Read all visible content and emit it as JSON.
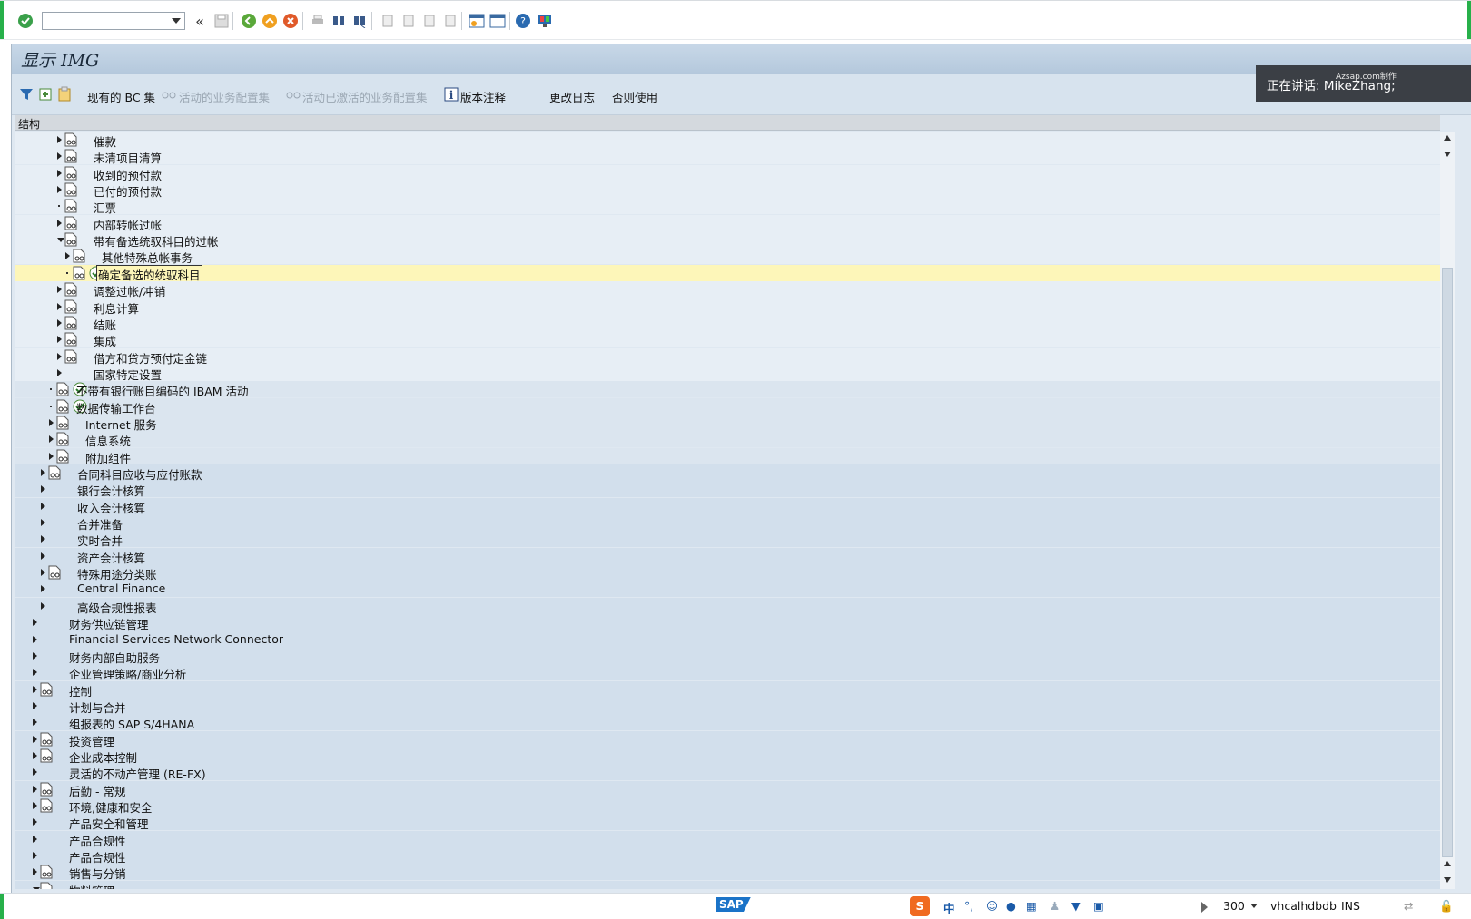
{
  "window_title": "显示 IMG",
  "toolbar": {
    "command_field_value": "",
    "back_label": "«"
  },
  "app_toolbar": {
    "current_bc_sets": "现有的 BC 集",
    "activated_bc_sets": "活动的业务配置集",
    "activated_bc_sets_for_activity": "活动已激活的业务配置集",
    "release_notes": "版本注释",
    "change_log": "更改日志",
    "deprecated": "否则使用"
  },
  "overlay": {
    "speaking": "正在讲话: MikeZhang;",
    "watermark": "Azsap.com制作"
  },
  "column_header": "结构",
  "tree_rows": [
    {
      "label": "催款",
      "indent": 3,
      "arrow": "r",
      "doc": true,
      "check": false
    },
    {
      "label": "未清项目清算",
      "indent": 3,
      "arrow": "r",
      "doc": true,
      "check": false
    },
    {
      "label": "收到的预付款",
      "indent": 3,
      "arrow": "r",
      "doc": true,
      "check": false
    },
    {
      "label": "已付的预付款",
      "indent": 3,
      "arrow": "r",
      "doc": true,
      "check": false
    },
    {
      "label": "汇票",
      "indent": 3,
      "arrow": "dot",
      "doc": true,
      "check": false
    },
    {
      "label": "内部转帐过帐",
      "indent": 3,
      "arrow": "r",
      "doc": true,
      "check": false
    },
    {
      "label": "带有备选统驭科目的过帐",
      "indent": 3,
      "arrow": "d",
      "doc": true,
      "check": false
    },
    {
      "label": "其他特殊总帐事务",
      "indent": 4,
      "arrow": "r",
      "doc": true,
      "check": false
    },
    {
      "label": "确定备选的统驭科目",
      "indent": 4,
      "arrow": "dot",
      "doc": true,
      "check": true,
      "selected": true
    },
    {
      "label": "调整过帐/冲销",
      "indent": 3,
      "arrow": "r",
      "doc": true,
      "check": false
    },
    {
      "label": "利息计算",
      "indent": 3,
      "arrow": "r",
      "doc": true,
      "check": false
    },
    {
      "label": "结账",
      "indent": 3,
      "arrow": "r",
      "doc": true,
      "check": false
    },
    {
      "label": "集成",
      "indent": 3,
      "arrow": "r",
      "doc": true,
      "check": false
    },
    {
      "label": "借方和贷方预付定金链",
      "indent": 3,
      "arrow": "r",
      "doc": true,
      "check": false
    },
    {
      "label": "国家特定设置",
      "indent": 3,
      "arrow": "r",
      "doc": false,
      "check": false
    },
    {
      "label": "不带有银行账目编码的 IBAM 活动",
      "indent": 2,
      "arrow": "dot",
      "doc": true,
      "check": true
    },
    {
      "label": "数据传输工作台",
      "indent": 2,
      "arrow": "dot",
      "doc": true,
      "check": true
    },
    {
      "label": "Internet 服务",
      "indent": 2,
      "arrow": "r",
      "doc": true,
      "check": false
    },
    {
      "label": "信息系统",
      "indent": 2,
      "arrow": "r",
      "doc": true,
      "check": false
    },
    {
      "label": "附加组件",
      "indent": 2,
      "arrow": "r",
      "doc": true,
      "check": false
    },
    {
      "label": "合同科目应收与应付账款",
      "indent": 1,
      "arrow": "r",
      "doc": true,
      "check": false
    },
    {
      "label": "银行会计核算",
      "indent": 1,
      "arrow": "r",
      "doc": false,
      "check": false
    },
    {
      "label": "收入会计核算",
      "indent": 1,
      "arrow": "r",
      "doc": false,
      "check": false
    },
    {
      "label": "合并准备",
      "indent": 1,
      "arrow": "r",
      "doc": false,
      "check": false
    },
    {
      "label": "实时合并",
      "indent": 1,
      "arrow": "r",
      "doc": false,
      "check": false
    },
    {
      "label": "资产会计核算",
      "indent": 1,
      "arrow": "r",
      "doc": false,
      "check": false
    },
    {
      "label": "特殊用途分类账",
      "indent": 1,
      "arrow": "r",
      "doc": true,
      "check": false
    },
    {
      "label": "Central Finance",
      "indent": 1,
      "arrow": "r",
      "doc": false,
      "check": false
    },
    {
      "label": "高级合规性报表",
      "indent": 1,
      "arrow": "r",
      "doc": false,
      "check": false
    },
    {
      "label": "财务供应链管理",
      "indent": 0,
      "arrow": "r",
      "doc": false,
      "check": false
    },
    {
      "label": "Financial Services Network Connector",
      "indent": 0,
      "arrow": "r",
      "doc": false,
      "check": false
    },
    {
      "label": "财务内部自助服务",
      "indent": 0,
      "arrow": "r",
      "doc": false,
      "check": false
    },
    {
      "label": "企业管理策略/商业分析",
      "indent": 0,
      "arrow": "r",
      "doc": false,
      "check": false
    },
    {
      "label": "控制",
      "indent": 0,
      "arrow": "r",
      "doc": true,
      "check": false
    },
    {
      "label": "计划与合并",
      "indent": 0,
      "arrow": "r",
      "doc": false,
      "check": false
    },
    {
      "label": "组报表的 SAP S/4HANA",
      "indent": 0,
      "arrow": "r",
      "doc": false,
      "check": false
    },
    {
      "label": "投资管理",
      "indent": 0,
      "arrow": "r",
      "doc": true,
      "check": false
    },
    {
      "label": "企业成本控制",
      "indent": 0,
      "arrow": "r",
      "doc": true,
      "check": false
    },
    {
      "label": "灵活的不动产管理 (RE-FX)",
      "indent": 0,
      "arrow": "r",
      "doc": false,
      "check": false
    },
    {
      "label": "后勤 - 常规",
      "indent": 0,
      "arrow": "r",
      "doc": true,
      "check": false
    },
    {
      "label": "环境,健康和安全",
      "indent": 0,
      "arrow": "r",
      "doc": true,
      "check": false
    },
    {
      "label": "产品安全和管理",
      "indent": 0,
      "arrow": "r",
      "doc": false,
      "check": false
    },
    {
      "label": "产品合规性",
      "indent": 0,
      "arrow": "r",
      "doc": false,
      "check": false
    },
    {
      "label": "产品合规性",
      "indent": 0,
      "arrow": "r",
      "doc": false,
      "check": false
    },
    {
      "label": "销售与分销",
      "indent": 0,
      "arrow": "r",
      "doc": true,
      "check": false
    },
    {
      "label": "物料管理",
      "indent": 0,
      "arrow": "d",
      "doc": true,
      "check": false
    }
  ],
  "status_bar": {
    "sap_logo": "SAP",
    "ime_label": "中",
    "ime_punct": "°,",
    "session_value": "300",
    "server": "vhcalhdbdb",
    "mode": "INS"
  }
}
